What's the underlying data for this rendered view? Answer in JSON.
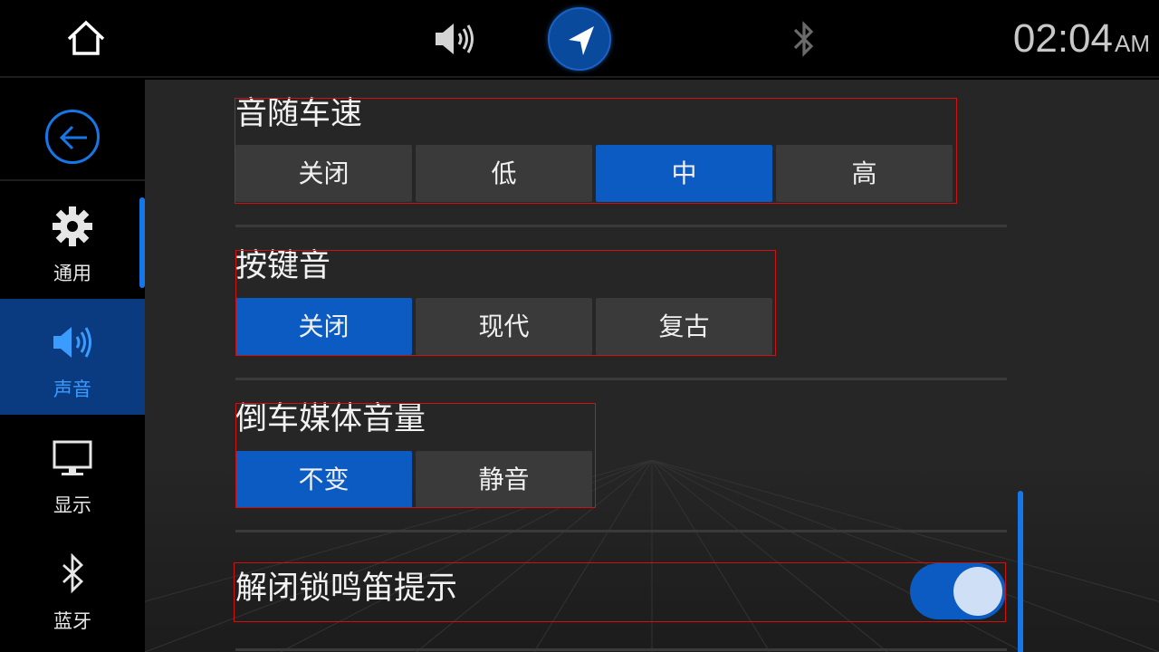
{
  "topbar": {
    "home_icon": "home-icon",
    "volume_icon": "speaker-icon",
    "nav_icon": "navigation-arrow-icon",
    "bluetooth_icon": "bluetooth-icon",
    "time": "02:04",
    "ampm": "AM"
  },
  "sidebar": {
    "back_icon": "back-arrow-icon",
    "items": [
      {
        "label": "通用",
        "icon": "gear-icon",
        "active": false
      },
      {
        "label": "声音",
        "icon": "speaker-icon",
        "active": true
      },
      {
        "label": "显示",
        "icon": "monitor-icon",
        "active": false
      },
      {
        "label": "蓝牙",
        "icon": "bluetooth-icon",
        "active": false
      }
    ]
  },
  "settings": {
    "speed_volume": {
      "title": "音随车速",
      "options": [
        "关闭",
        "低",
        "中",
        "高"
      ],
      "selected": "中"
    },
    "key_tone": {
      "title": "按键音",
      "options": [
        "关闭",
        "现代",
        "复古"
      ],
      "selected": "关闭"
    },
    "reverse_media_volume": {
      "title": "倒车媒体音量",
      "options": [
        "不变",
        "静音"
      ],
      "selected": "不变"
    },
    "unlock_horn": {
      "title": "解闭锁鸣笛提示",
      "enabled": true
    }
  },
  "colors": {
    "accent": "#0b5bc2",
    "accent_bright": "#1577e8",
    "segment_bg": "#3a3a3a",
    "frame": "#d21010"
  }
}
